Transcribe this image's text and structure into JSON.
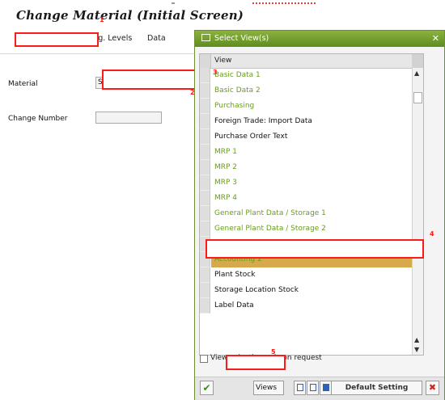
{
  "screen": {
    "title": "Change Material (Initial Screen)",
    "menu": [
      "Org. Levels",
      "Data"
    ],
    "material_label": "Material",
    "material_value": "S",
    "change_number_label": "Change Number"
  },
  "annotations": [
    "1",
    "2",
    "3",
    "4",
    "5"
  ],
  "dialog": {
    "title": "Select View(s)",
    "close_glyph": "✕",
    "column_header": "View",
    "views": [
      {
        "label": "Basic Data 1",
        "color": "#6a9c1d",
        "selected": false
      },
      {
        "label": "Basic Data 2",
        "color": "#6a9c1d",
        "selected": false
      },
      {
        "label": "Purchasing",
        "color": "#6a9c1d",
        "selected": false
      },
      {
        "label": "Foreign Trade: Import Data",
        "color": "#111111",
        "selected": false
      },
      {
        "label": "Purchase Order Text",
        "color": "#111111",
        "selected": false
      },
      {
        "label": "MRP 1",
        "color": "#6a9c1d",
        "selected": false
      },
      {
        "label": "MRP 2",
        "color": "#6a9c1d",
        "selected": false
      },
      {
        "label": "MRP 3",
        "color": "#6a9c1d",
        "selected": false
      },
      {
        "label": "MRP 4",
        "color": "#6a9c1d",
        "selected": false
      },
      {
        "label": "General Plant Data / Storage 1",
        "color": "#6a9c1d",
        "selected": false
      },
      {
        "label": "General Plant Data / Storage 2",
        "color": "#6a9c1d",
        "selected": false
      },
      {
        "label": "",
        "color": "#6a9c1d",
        "selected": false
      },
      {
        "label": "Accounting 2",
        "color": "#6a9c1d",
        "selected": true
      },
      {
        "label": "Plant Stock",
        "color": "#111111",
        "selected": false
      },
      {
        "label": "Storage Location Stock",
        "color": "#111111",
        "selected": false
      },
      {
        "label": "Label Data",
        "color": "#111111",
        "selected": false
      }
    ],
    "checkbox_label": "View selection only on request",
    "toolbar": {
      "ok_glyph": "✔",
      "views_label": "Views",
      "default_label": "Default Setting",
      "cancel_glyph": "✖"
    }
  },
  "colors": {
    "title_bar": "#6e9a28",
    "highlight": "#d8a94b",
    "annotation_red": "#ff1a1a"
  }
}
